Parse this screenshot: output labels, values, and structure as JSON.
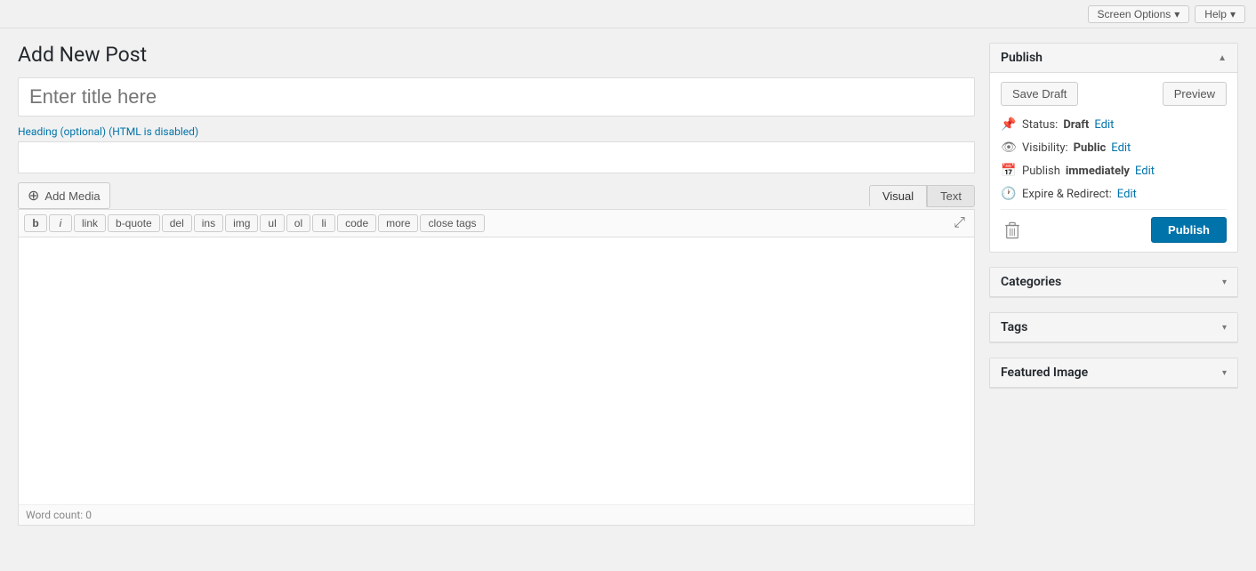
{
  "topbar": {
    "screen_options_label": "Screen Options",
    "help_label": "Help"
  },
  "page": {
    "title": "Add New Post"
  },
  "title_field": {
    "placeholder": "Enter title here"
  },
  "heading": {
    "label": "Heading (optional) (HTML is disabled)"
  },
  "editor": {
    "add_media_label": "Add Media",
    "tab_visual": "Visual",
    "tab_text": "Text",
    "format_buttons": [
      "b",
      "i",
      "link",
      "b-quote",
      "del",
      "ins",
      "img",
      "ul",
      "ol",
      "li",
      "code",
      "more",
      "close tags"
    ],
    "word_count_label": "Word count:",
    "word_count_value": "0"
  },
  "publish_panel": {
    "title": "Publish",
    "save_draft_label": "Save Draft",
    "preview_label": "Preview",
    "status_label": "Status:",
    "status_value": "Draft",
    "status_edit": "Edit",
    "visibility_label": "Visibility:",
    "visibility_value": "Public",
    "visibility_edit": "Edit",
    "publish_time_label": "Publish",
    "publish_time_value": "immediately",
    "publish_time_edit": "Edit",
    "expire_label": "Expire & Redirect:",
    "expire_edit": "Edit",
    "publish_button_label": "Publish"
  },
  "categories_panel": {
    "title": "Categories"
  },
  "tags_panel": {
    "title": "Tags"
  },
  "featured_image_panel": {
    "title": "Featured Image"
  }
}
